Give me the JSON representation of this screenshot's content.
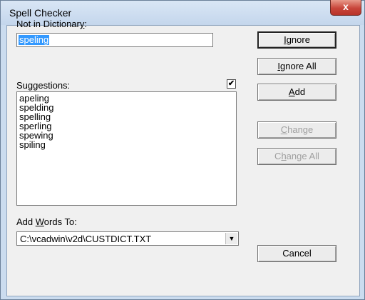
{
  "window": {
    "title": "Spell Checker",
    "close_glyph": "x"
  },
  "not_in_dictionary": {
    "label_pre": "Not in Dictionar",
    "label_key": "y",
    "label_post": ":",
    "value": "speling"
  },
  "suggestions": {
    "label": "Suggestions:",
    "checkbox_glyph": "✔",
    "checkbox_checked": true,
    "items": [
      "apeling",
      "spelding",
      "spelling",
      "sperling",
      "spewing",
      "spiling"
    ]
  },
  "add_words_to": {
    "label_pre": "Add ",
    "label_key": "W",
    "label_post": "ords To:",
    "value": "C:\\vcadwin\\v2d\\CUSTDICT.TXT",
    "arrow_glyph": "▼"
  },
  "buttons": {
    "ignore": {
      "key": "I",
      "rest": "gnore"
    },
    "ignore_all": {
      "key": "I",
      "rest": "gnore All"
    },
    "add": {
      "key": "A",
      "rest": "dd"
    },
    "change": {
      "key": "C",
      "rest": "hange"
    },
    "change_all": {
      "pre": "C",
      "key": "h",
      "rest": "ange All"
    },
    "cancel": "Cancel"
  }
}
